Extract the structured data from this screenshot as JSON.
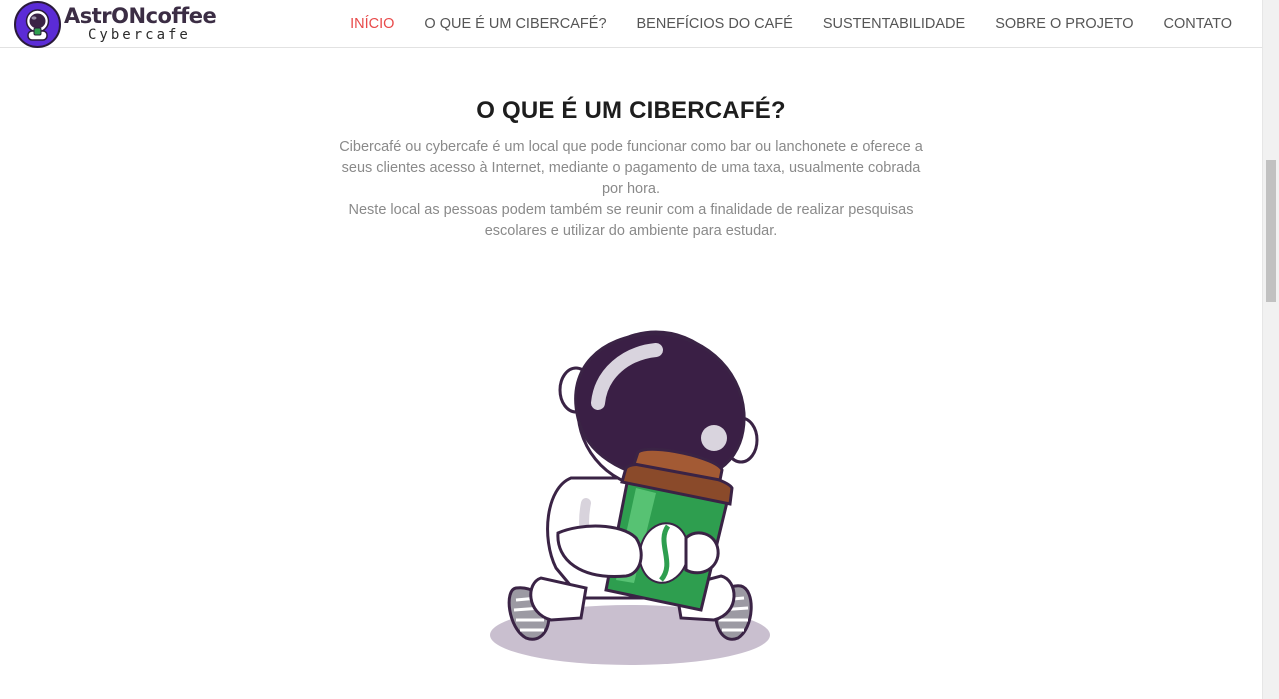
{
  "brand": {
    "title": "AstrONcoffee",
    "subtitle": "Cybercafe"
  },
  "nav": {
    "items": [
      {
        "label": "INÍCIO",
        "active": true
      },
      {
        "label": "O QUE É UM CIBERCAFÉ?",
        "active": false
      },
      {
        "label": "BENEFÍCIOS DO CAFÉ",
        "active": false
      },
      {
        "label": "SUSTENTABILIDADE",
        "active": false
      },
      {
        "label": "SOBRE O PROJETO",
        "active": false
      },
      {
        "label": "CONTATO",
        "active": false
      }
    ]
  },
  "section": {
    "title": "O QUE É UM CIBERCAFÉ?",
    "paragraph1": "Cibercafé ou cybercafe é um local que pode funcionar como bar ou lanchonete e oferece a seus clientes acesso à Internet, mediante o pagamento de uma taxa, usualmente cobrada por hora.",
    "paragraph2": "Neste local as pessoas podem também se reunir com a finalidade de realizar pesquisas escolares e utilizar do ambiente para estudar."
  },
  "colors": {
    "accent": "#e84a4a",
    "nav_text": "#555555",
    "body_text": "#8a8a8a",
    "brand_purple": "#3b2d44",
    "cup_green": "#2e9e4f",
    "lid_brown": "#8a4a2a"
  },
  "icons": {
    "logo": "astronaut-coffee-logo",
    "illustration": "astronaut-holding-coffee-cup"
  }
}
